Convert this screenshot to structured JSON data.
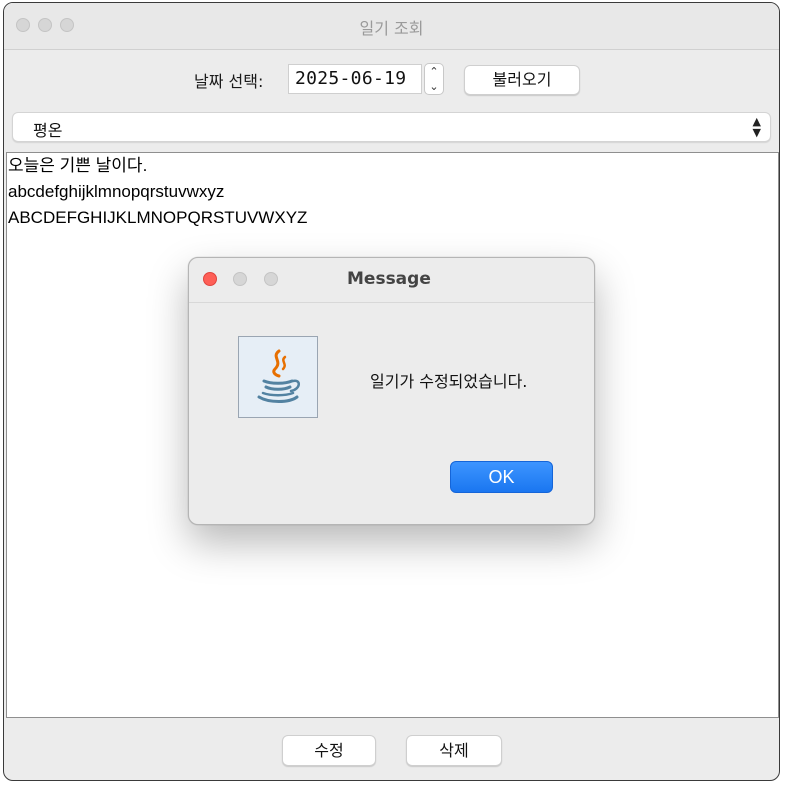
{
  "window": {
    "title": "일기 조회"
  },
  "toolbar": {
    "date_label": "날짜 선택:",
    "date_value": "2025-06-19",
    "stepper_up": "⌃",
    "stepper_down": "⌄",
    "load_button": "불러오기"
  },
  "weather_select": {
    "selected": "평온",
    "arrows": "⌃⌄"
  },
  "diary": {
    "lines": [
      "오늘은 기쁜 날이다.",
      "abcdefghijklmnopqrstuvwxyz",
      "ABCDEFGHIJKLMNOPQRSTUVWXYZ"
    ]
  },
  "bottom": {
    "edit_button": "수정",
    "delete_button": "삭제"
  },
  "dialog": {
    "title": "Message",
    "message": "일기가 수정되었습니다.",
    "ok_button": "OK",
    "icon": "java-coffee-cup-icon"
  },
  "colors": {
    "close_red": "#fe5f57",
    "traffic_grey": "#d6d6d6",
    "ok_blue": "#1a76f0"
  }
}
